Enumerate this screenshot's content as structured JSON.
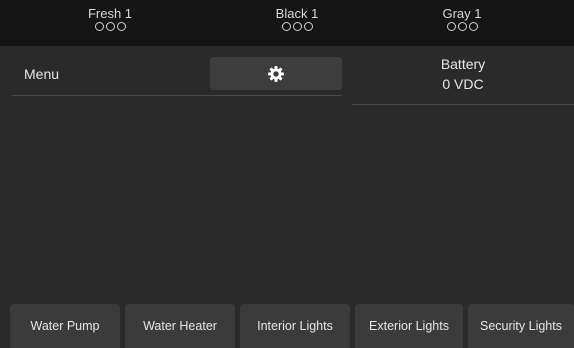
{
  "tanks": [
    {
      "name": "Fresh 1",
      "level_dots": 3,
      "filled": 0
    },
    {
      "name": "Black 1",
      "level_dots": 3,
      "filled": 0
    },
    {
      "name": "Gray 1",
      "level_dots": 3,
      "filled": 0
    }
  ],
  "menu": {
    "label": "Menu",
    "settings_icon": "gear-icon"
  },
  "battery": {
    "label": "Battery",
    "value": "0 VDC"
  },
  "bottom_buttons": [
    {
      "label": "Water Pump"
    },
    {
      "label": "Water Heater"
    },
    {
      "label": "Interior Lights"
    },
    {
      "label": "Exterior Lights"
    },
    {
      "label": "Security Lights"
    }
  ],
  "colors": {
    "background": "#2a2a2a",
    "topbar": "#151515",
    "button": "#3b3b3b",
    "text": "#e6e6e6"
  }
}
